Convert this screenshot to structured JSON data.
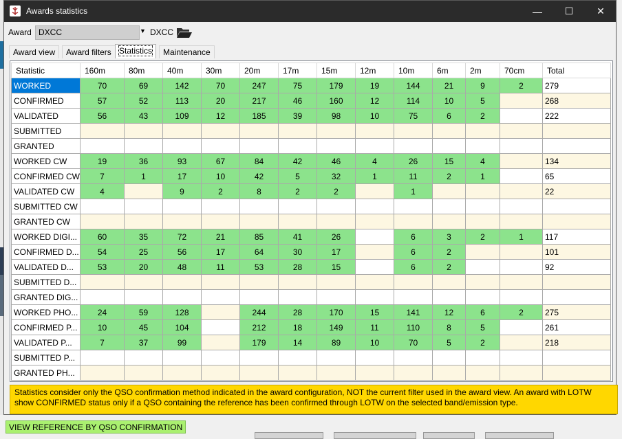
{
  "window": {
    "title": "Awards statistics",
    "controls": {
      "minimize": "—",
      "maximize": "☐",
      "close": "✕"
    }
  },
  "award": {
    "label": "Award",
    "selected": "DXCC",
    "code": "DXCC",
    "dropdown_icon": "chevron-down-icon",
    "open_icon": "folder-open-icon"
  },
  "tabs": [
    {
      "label": "Award view",
      "active": false
    },
    {
      "label": "Award filters",
      "active": false
    },
    {
      "label": "Statistics",
      "active": true
    },
    {
      "label": "Maintenance",
      "active": false
    }
  ],
  "table": {
    "columns": [
      "Statistic",
      "160m",
      "80m",
      "40m",
      "30m",
      "20m",
      "17m",
      "15m",
      "12m",
      "10m",
      "6m",
      "2m",
      "70cm",
      "Total"
    ],
    "rows": [
      {
        "label": "WORKED",
        "selected": true,
        "cells": [
          "70",
          "69",
          "142",
          "70",
          "247",
          "75",
          "179",
          "19",
          "144",
          "21",
          "9",
          "2"
        ],
        "total": "279"
      },
      {
        "label": "CONFIRMED",
        "cells": [
          "57",
          "52",
          "113",
          "20",
          "217",
          "46",
          "160",
          "12",
          "114",
          "10",
          "5",
          ""
        ],
        "total": "268"
      },
      {
        "label": "VALIDATED",
        "cells": [
          "56",
          "43",
          "109",
          "12",
          "185",
          "39",
          "98",
          "10",
          "75",
          "6",
          "2",
          ""
        ],
        "total": "222"
      },
      {
        "label": "SUBMITTED",
        "cells": [
          "",
          "",
          "",
          "",
          "",
          "",
          "",
          "",
          "",
          "",
          "",
          ""
        ],
        "total": ""
      },
      {
        "label": "GRANTED",
        "cells": [
          "",
          "",
          "",
          "",
          "",
          "",
          "",
          "",
          "",
          "",
          "",
          ""
        ],
        "total": ""
      },
      {
        "label": "WORKED CW",
        "cells": [
          "19",
          "36",
          "93",
          "67",
          "84",
          "42",
          "46",
          "4",
          "26",
          "15",
          "4",
          ""
        ],
        "total": "134"
      },
      {
        "label": "CONFIRMED CW",
        "cells": [
          "7",
          "1",
          "17",
          "10",
          "42",
          "5",
          "32",
          "1",
          "11",
          "2",
          "1",
          ""
        ],
        "total": "65"
      },
      {
        "label": "VALIDATED CW",
        "cells": [
          "4",
          "",
          "9",
          "2",
          "8",
          "2",
          "2",
          "",
          "1",
          "",
          "",
          ""
        ],
        "total": "22"
      },
      {
        "label": "SUBMITTED CW",
        "cells": [
          "",
          "",
          "",
          "",
          "",
          "",
          "",
          "",
          "",
          "",
          "",
          ""
        ],
        "total": ""
      },
      {
        "label": "GRANTED CW",
        "cells": [
          "",
          "",
          "",
          "",
          "",
          "",
          "",
          "",
          "",
          "",
          "",
          ""
        ],
        "total": ""
      },
      {
        "label": "WORKED DIGI...",
        "cells": [
          "60",
          "35",
          "72",
          "21",
          "85",
          "41",
          "26",
          "",
          "6",
          "3",
          "2",
          "1"
        ],
        "total": "117"
      },
      {
        "label": "CONFIRMED D...",
        "cells": [
          "54",
          "25",
          "56",
          "17",
          "64",
          "30",
          "17",
          "",
          "6",
          "2",
          "",
          ""
        ],
        "total": "101"
      },
      {
        "label": "VALIDATED D...",
        "cells": [
          "53",
          "20",
          "48",
          "11",
          "53",
          "28",
          "15",
          "",
          "6",
          "2",
          "",
          ""
        ],
        "total": "92"
      },
      {
        "label": "SUBMITTED D...",
        "cells": [
          "",
          "",
          "",
          "",
          "",
          "",
          "",
          "",
          "",
          "",
          "",
          ""
        ],
        "total": ""
      },
      {
        "label": "GRANTED DIG...",
        "cells": [
          "",
          "",
          "",
          "",
          "",
          "",
          "",
          "",
          "",
          "",
          "",
          ""
        ],
        "total": ""
      },
      {
        "label": "WORKED PHO...",
        "cells": [
          "24",
          "59",
          "128",
          "",
          "244",
          "28",
          "170",
          "15",
          "141",
          "12",
          "6",
          "2"
        ],
        "total": "275"
      },
      {
        "label": "CONFIRMED P...",
        "cells": [
          "10",
          "45",
          "104",
          "",
          "212",
          "18",
          "149",
          "11",
          "110",
          "8",
          "5",
          ""
        ],
        "total": "261"
      },
      {
        "label": "VALIDATED P...",
        "cells": [
          "7",
          "37",
          "99",
          "",
          "179",
          "14",
          "89",
          "10",
          "70",
          "5",
          "2",
          ""
        ],
        "total": "218"
      },
      {
        "label": "SUBMITTED P...",
        "cells": [
          "",
          "",
          "",
          "",
          "",
          "",
          "",
          "",
          "",
          "",
          "",
          ""
        ],
        "total": ""
      },
      {
        "label": "GRANTED PH...",
        "cells": [
          "",
          "",
          "",
          "",
          "",
          "",
          "",
          "",
          "",
          "",
          "",
          ""
        ],
        "total": ""
      }
    ]
  },
  "colors": {
    "value_cell": "#8ce38c",
    "row_even": "#fdf7e2",
    "row_odd": "#ffffff",
    "selected": "#0078d7",
    "notice_bg": "#ffd700",
    "status_button": "#aaf070"
  },
  "notice": {
    "line1": "Statistics consider only the QSO confirmation method indicated in the award configuration, NOT the current filter used in the award view. An award with LOTW",
    "line2": "show CONFIRMED status only if a QSO containing the reference has been confirmed through LOTW on the selected band/emission type."
  },
  "status_button": {
    "label": "VIEW REFERENCE BY QSO CONFIRMATION"
  }
}
